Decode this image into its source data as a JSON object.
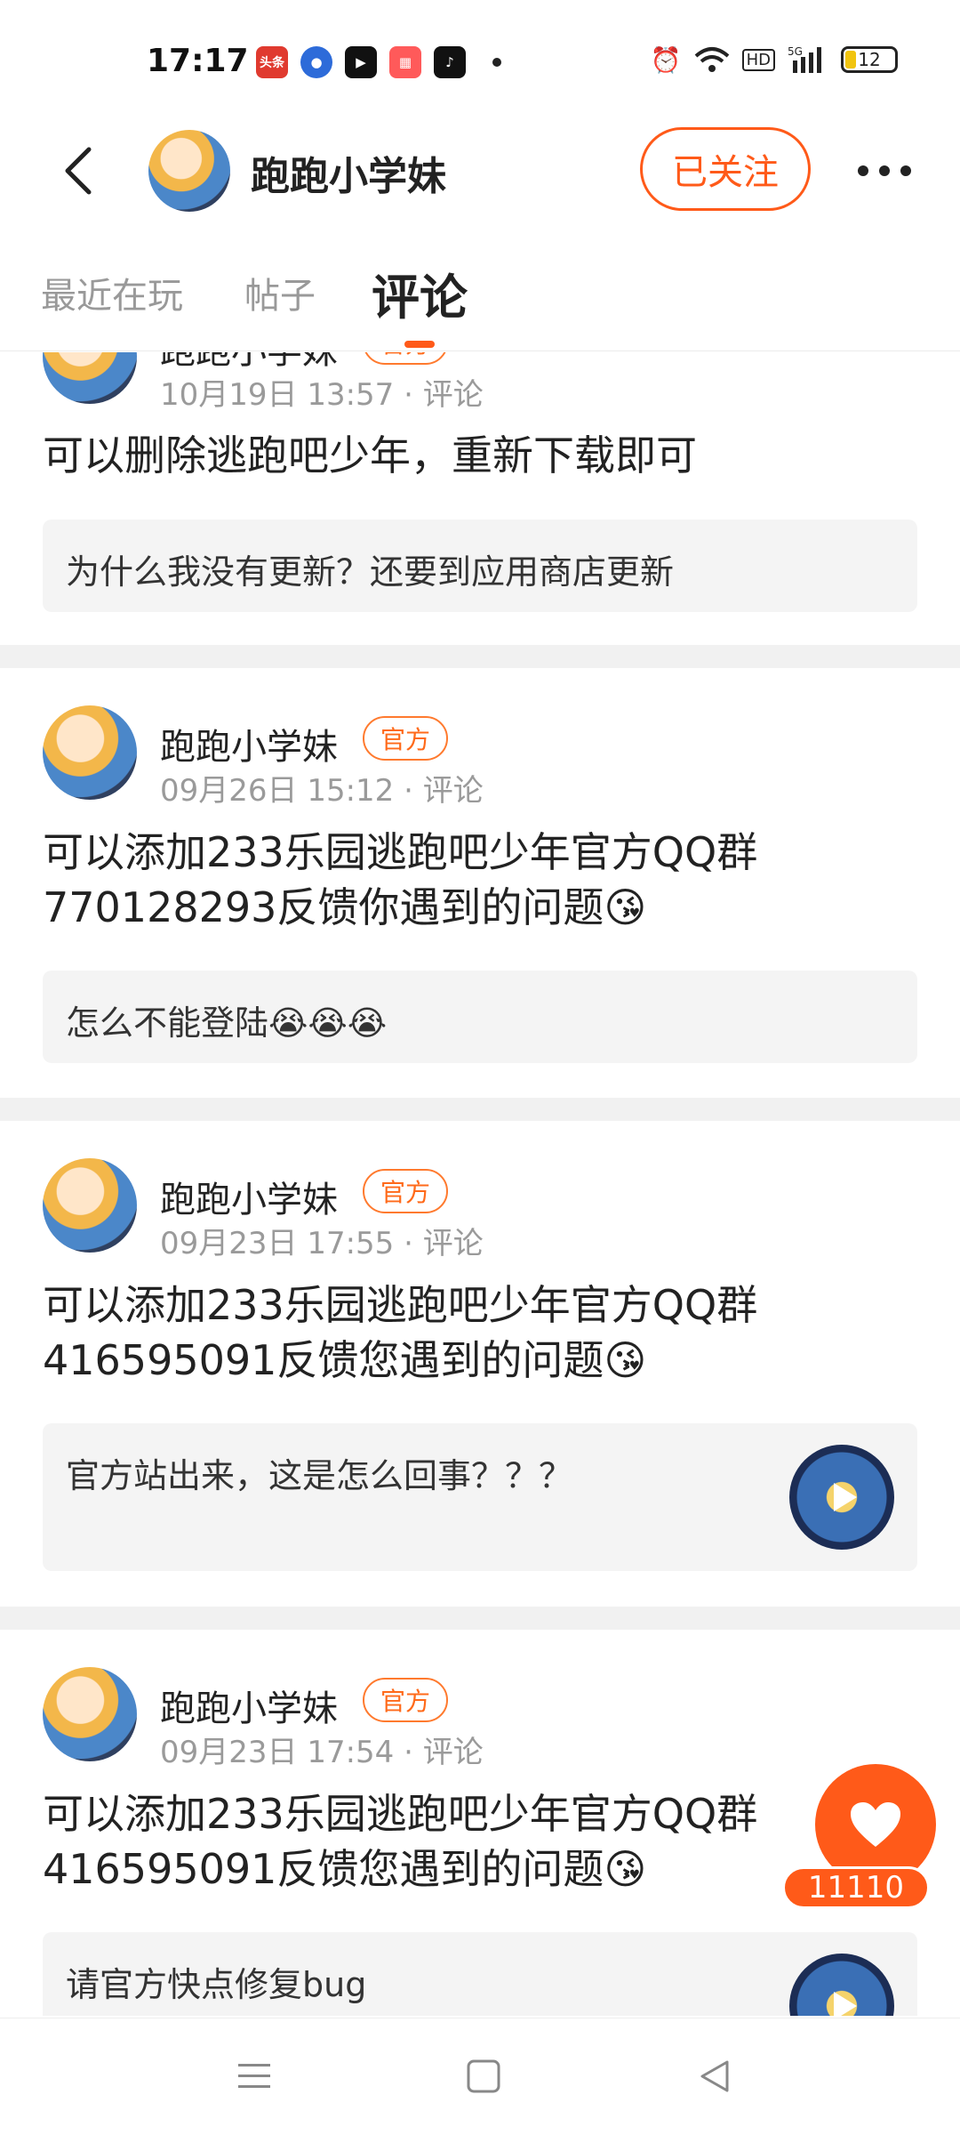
{
  "status_bar": {
    "time": "17:17",
    "notification_icons": [
      "toutiao-icon",
      "baidu-map-icon",
      "video-app-icon",
      "app-grid-icon",
      "tiktok-icon"
    ],
    "toutiao_label": "头条",
    "battery": "12"
  },
  "header": {
    "name": "跑跑小学妹",
    "follow_label": "已关注",
    "more_label": "•••"
  },
  "tabs": [
    {
      "label": "最近在玩",
      "active": false
    },
    {
      "label": "帖子",
      "active": false
    },
    {
      "label": "评论",
      "active": true
    }
  ],
  "posts": [
    {
      "name": "跑跑小学妹",
      "badge": "官方",
      "meta": "10月19日 13:57 · 评论",
      "text": "可以删除逃跑吧少年，重新下载即可",
      "quote": "为什么我没有更新？还要到应用商店更新"
    },
    {
      "name": "跑跑小学妹",
      "badge": "官方",
      "meta": "09月26日 15:12 · 评论",
      "text": "可以添加233乐园逃跑吧少年官方QQ群770128293反馈你遇到的问题😘",
      "quote": "怎么不能登陆😭😭😭"
    },
    {
      "name": "跑跑小学妹",
      "badge": "官方",
      "meta": "09月23日 17:55 · 评论",
      "text": "可以添加233乐园逃跑吧少年官方QQ群416595091反馈您遇到的问题😘",
      "quote": "官方站出来，这是怎么回事？？？"
    },
    {
      "name": "跑跑小学妹",
      "badge": "官方",
      "meta": "09月23日 17:54 · 评论",
      "text": "可以添加233乐园逃跑吧少年官方QQ群416595091反馈您遇到的问题😘",
      "quote": "请官方快点修复bug"
    }
  ],
  "like": {
    "count": "11110"
  },
  "colors": {
    "accent": "#ff5a19",
    "badge": "#ff6a1a"
  }
}
